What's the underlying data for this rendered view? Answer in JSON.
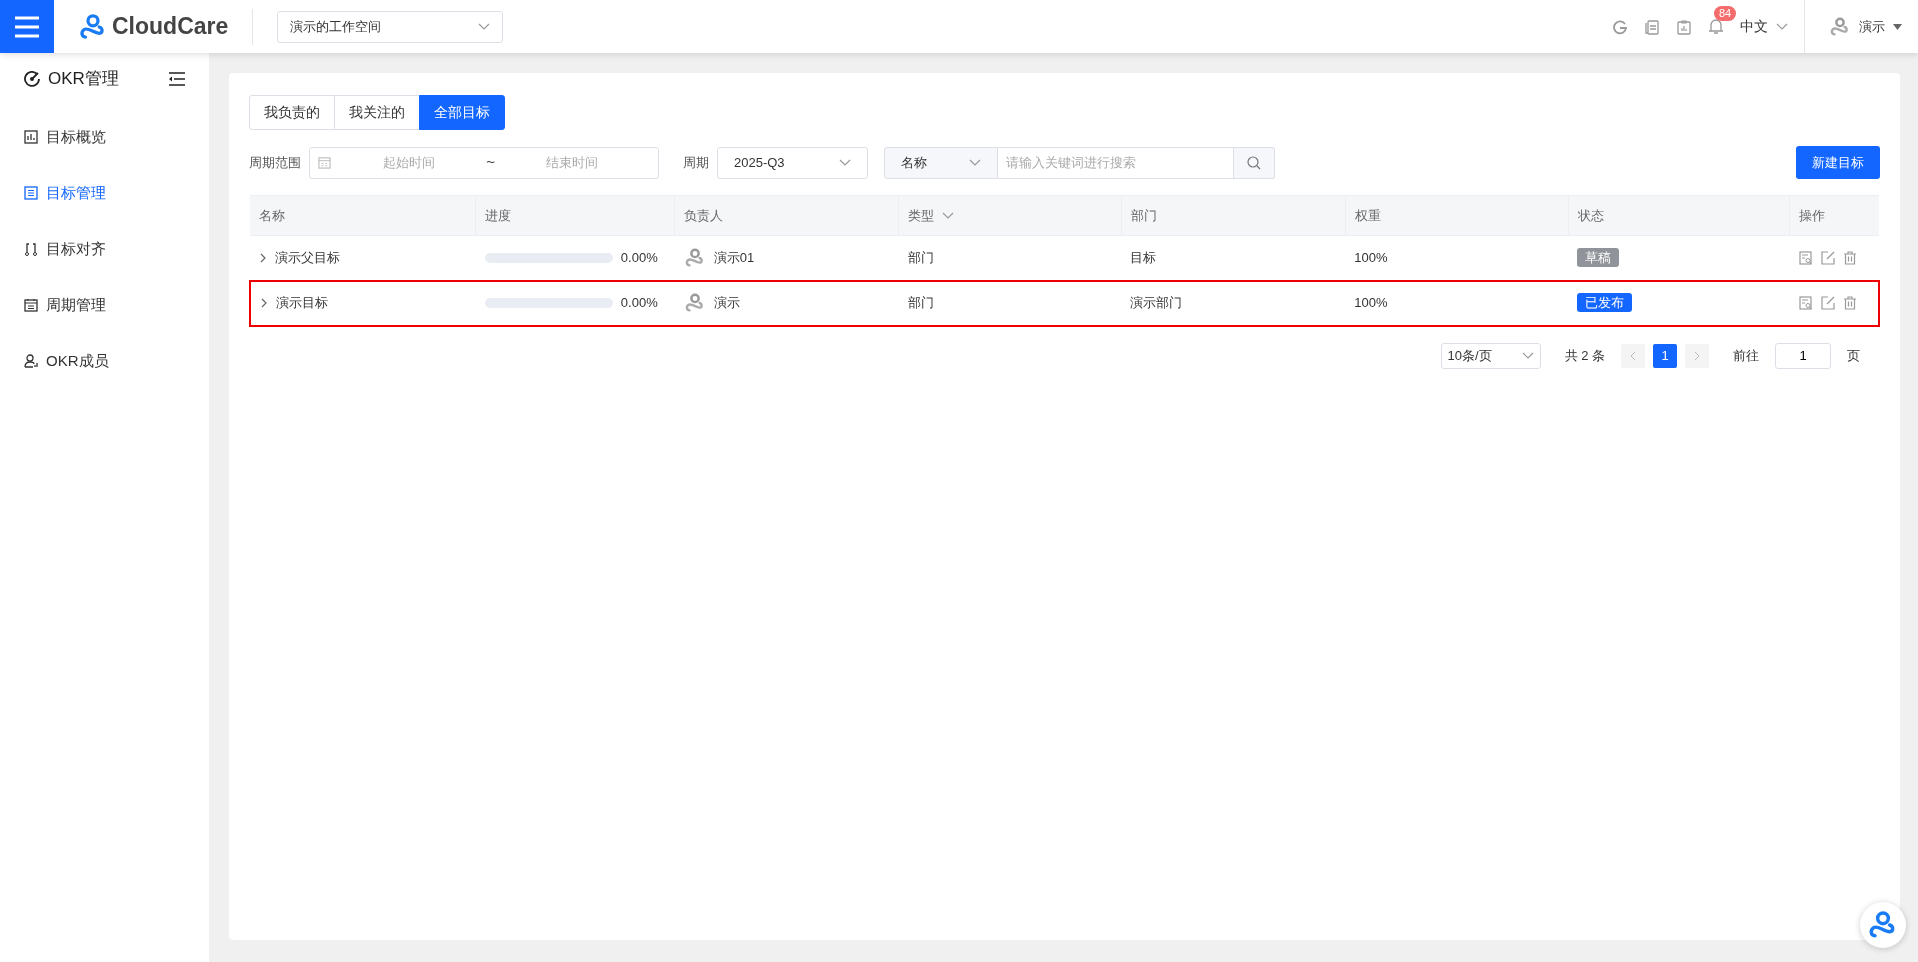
{
  "header": {
    "logo_text": "CloudCare",
    "workspace": "演示的工作空间",
    "notification_count": "84",
    "language": "中文",
    "user": "演示"
  },
  "sidebar": {
    "title": "OKR管理",
    "items": [
      {
        "label": "目标概览",
        "selected": false
      },
      {
        "label": "目标管理",
        "selected": true
      },
      {
        "label": "目标对齐",
        "selected": false
      },
      {
        "label": "周期管理",
        "selected": false
      },
      {
        "label": "OKR成员",
        "selected": false
      }
    ]
  },
  "tabs": [
    {
      "label": "我负责的",
      "selected": false
    },
    {
      "label": "我关注的",
      "selected": false
    },
    {
      "label": "全部目标",
      "selected": true
    }
  ],
  "filters": {
    "period_label": "周期范围",
    "start_placeholder": "起始时间",
    "range_separator": "~",
    "end_placeholder": "结束时间",
    "cycle_label": "周期",
    "cycle_value": "2025-Q3",
    "search_field": "名称",
    "search_placeholder": "请输入关键词进行搜索"
  },
  "new_button": "新建目标",
  "table": {
    "columns": [
      {
        "label": "名称",
        "filter": false
      },
      {
        "label": "进度",
        "filter": false
      },
      {
        "label": "负责人",
        "filter": false
      },
      {
        "label": "类型",
        "filter": true
      },
      {
        "label": "部门",
        "filter": false
      },
      {
        "label": "权重",
        "filter": false
      },
      {
        "label": "状态",
        "filter": false
      },
      {
        "label": "操作",
        "filter": false
      }
    ],
    "rows": [
      {
        "name": "演示父目标",
        "expanded": false,
        "level": 0,
        "progress": "0.00%",
        "owner": "演示01",
        "type": "部门",
        "department": "目标",
        "weight": "100%",
        "status": {
          "text": "草稿",
          "color": "#909399"
        },
        "highlighted": false
      },
      {
        "name": "演示目标",
        "expanded": false,
        "level": 0,
        "progress": "0.00%",
        "owner": "演示",
        "type": "部门",
        "department": "演示部门",
        "weight": "100%",
        "status": {
          "text": "已发布",
          "color": "#1366ff"
        },
        "highlighted": true
      }
    ]
  },
  "pagination": {
    "page_size": "10条/页",
    "total": "共 2 条",
    "pages": [
      {
        "label": "1",
        "selected": true
      }
    ],
    "goto_label": "前往",
    "goto_value": "1",
    "page_unit": "页"
  }
}
